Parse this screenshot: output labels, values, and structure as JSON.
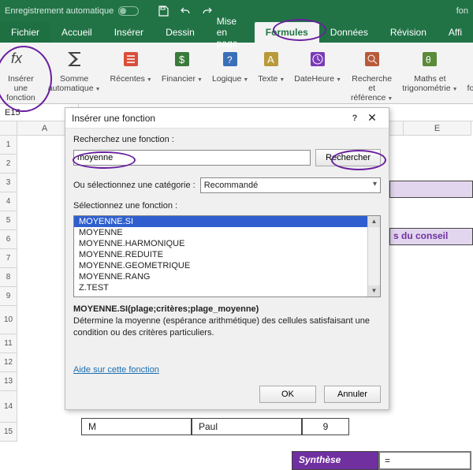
{
  "titlebar": {
    "autosave_label": "Enregistrement automatique",
    "right_text": "fon"
  },
  "tabs": {
    "fichier": "Fichier",
    "accueil": "Accueil",
    "inserer": "Insérer",
    "dessin": "Dessin",
    "mise_en_page": "Mise en page",
    "formules": "Formules",
    "donnees": "Données",
    "revision": "Révision",
    "affichage": "Affi"
  },
  "ribbon": {
    "inserer_fonction": "Insérer une\nfonction",
    "somme": "Somme\nautomatique",
    "recentes": "Récentes",
    "financier": "Financier",
    "logique": "Logique",
    "texte": "Texte",
    "dateheure": "DateHeure",
    "recherche": "Recherche et\nréférence",
    "maths": "Maths et\ntrigonométrie",
    "plus": "Plus de\nfonctions"
  },
  "namebox": "E15",
  "grid": {
    "columns": [
      "A",
      "E"
    ],
    "rows": [
      "1",
      "2",
      "3",
      "4",
      "5",
      "6",
      "7",
      "8",
      "9",
      "10",
      "11",
      "12",
      "13",
      "14",
      "15"
    ]
  },
  "dialog": {
    "title": "Insérer une fonction",
    "search_label": "Recherchez une fonction :",
    "search_value": "moyenne",
    "search_btn": "Rechercher",
    "category_label": "Ou sélectionnez une catégorie :",
    "category_value": "Recommandé",
    "select_label": "Sélectionnez une fonction :",
    "functions": [
      "MOYENNE.SI",
      "MOYENNE",
      "MOYENNE.HARMONIQUE",
      "MOYENNE.REDUITE",
      "MOYENNE.GEOMETRIQUE",
      "MOYENNE.RANG",
      "Z.TEST"
    ],
    "signature": "MOYENNE.SI(plage;critères;plage_moyenne)",
    "description": "Détermine la moyenne (espérance arithmétique) des cellules satisfaisant une condition ou des critères particuliers.",
    "help_link": "Aide sur cette fonction",
    "ok": "OK",
    "cancel": "Annuler"
  },
  "sheet": {
    "row13_col1": "M",
    "row13_col2": "Paul",
    "row13_col3": "9",
    "synthese_label": "Synthèse",
    "synthese_formula": "=",
    "conseil_fragment": "s du conseil"
  }
}
